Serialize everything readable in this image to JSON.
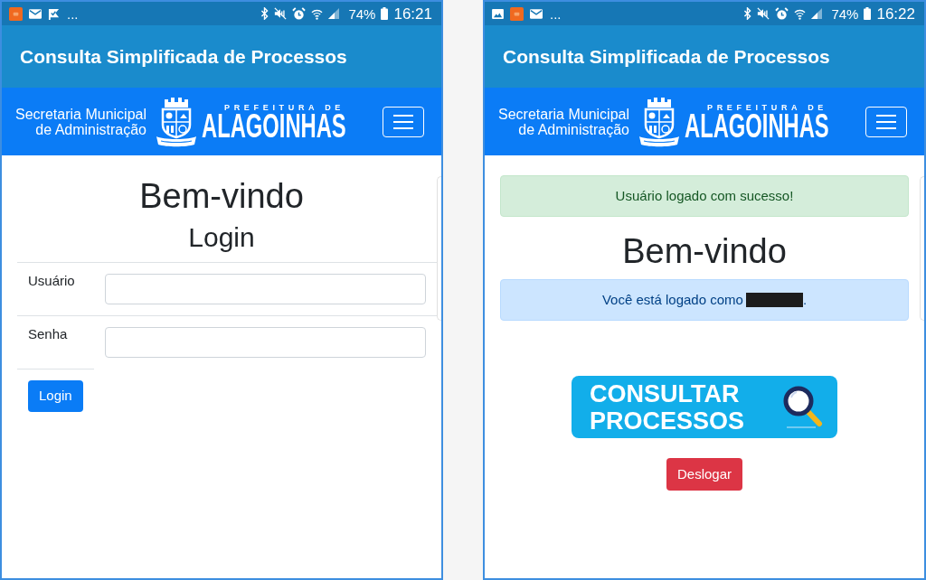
{
  "phones": [
    {
      "status_bar": {
        "notifications": [
          {
            "kind": "app"
          },
          {
            "kind": "mail"
          },
          {
            "kind": "flag"
          }
        ],
        "overflow": "...",
        "battery": "74%",
        "time": "16:21"
      },
      "app_bar": {
        "title": "Consulta Simplificada de Processos"
      },
      "navbar": {
        "department": "Secretaria Municipal de Administração",
        "logo_caption": "PREFEITURA DE",
        "logo_name": "ALAGOINHAS"
      },
      "content": [
        {
          "kind": "heading",
          "text": "Bem-vindo"
        },
        {
          "kind": "subheading",
          "text": "Login"
        },
        {
          "kind": "login_form",
          "fields": [
            {
              "label": "Usuário"
            },
            {
              "label": "Senha"
            }
          ],
          "submit": "Login"
        }
      ]
    },
    {
      "status_bar": {
        "notifications": [
          {
            "kind": "image"
          },
          {
            "kind": "app"
          },
          {
            "kind": "mail"
          }
        ],
        "overflow": "...",
        "battery": "74%",
        "time": "16:22"
      },
      "app_bar": {
        "title": "Consulta Simplificada de Processos"
      },
      "navbar": {
        "department": "Secretaria Municipal de Administração",
        "logo_caption": "PREFEITURA DE",
        "logo_name": "ALAGOINHAS"
      },
      "content": [
        {
          "kind": "success_alert",
          "text": "Usuário logado com sucesso!"
        },
        {
          "kind": "heading",
          "text": "Bem-vindo"
        },
        {
          "kind": "info_alert",
          "text": "Você está logado como",
          "redacted": true,
          "suffix": "."
        },
        {
          "kind": "banner_button",
          "text": "CONSULTAR PROCESSOS"
        },
        {
          "kind": "danger_button",
          "text": "Deslogar"
        }
      ]
    }
  ]
}
